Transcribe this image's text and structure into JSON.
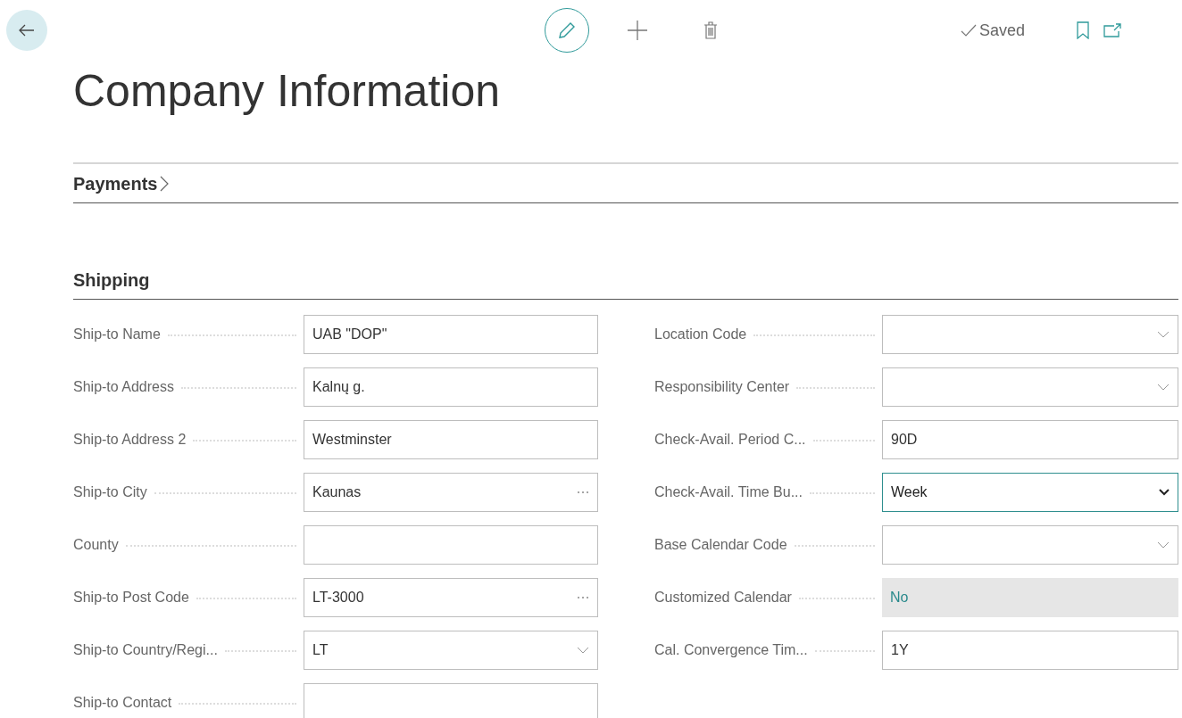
{
  "toolbar": {
    "status": "Saved"
  },
  "title": "Company Information",
  "sections": [
    {
      "title": "Payments",
      "collapsed": true
    },
    {
      "title": "Shipping",
      "collapsed": false
    }
  ],
  "left_fields": [
    {
      "label": "Ship-to Name",
      "value": "UAB \"DOP\"",
      "kind": "text"
    },
    {
      "label": "Ship-to Address",
      "value": "Kalnų g.",
      "kind": "text"
    },
    {
      "label": "Ship-to Address 2",
      "value": "Westminster",
      "kind": "text"
    },
    {
      "label": "Ship-to City",
      "value": "Kaunas",
      "kind": "lookup"
    },
    {
      "label": "County",
      "kind": "text"
    },
    {
      "label": "Ship-to Post Code",
      "value": "LT-3000",
      "kind": "lookup"
    },
    {
      "label": "Ship-to Country/Regi...",
      "value": "LT",
      "kind": "dropdown"
    },
    {
      "label": "Ship-to Contact",
      "kind": "text"
    }
  ],
  "right_fields": [
    {
      "label": "Location Code",
      "kind": "dropdown"
    },
    {
      "label": "Responsibility Center",
      "kind": "dropdown"
    },
    {
      "label": "Check-Avail. Period C...",
      "value": "90D",
      "kind": "text"
    },
    {
      "label": "Check-Avail. Time Bu...",
      "value": "Week",
      "kind": "select"
    },
    {
      "label": "Base Calendar Code",
      "kind": "dropdown"
    },
    {
      "label": "Customized Calendar",
      "value": "No",
      "kind": "readonly"
    },
    {
      "label": "Cal. Convergence Tim...",
      "value": "1Y",
      "kind": "text"
    }
  ]
}
